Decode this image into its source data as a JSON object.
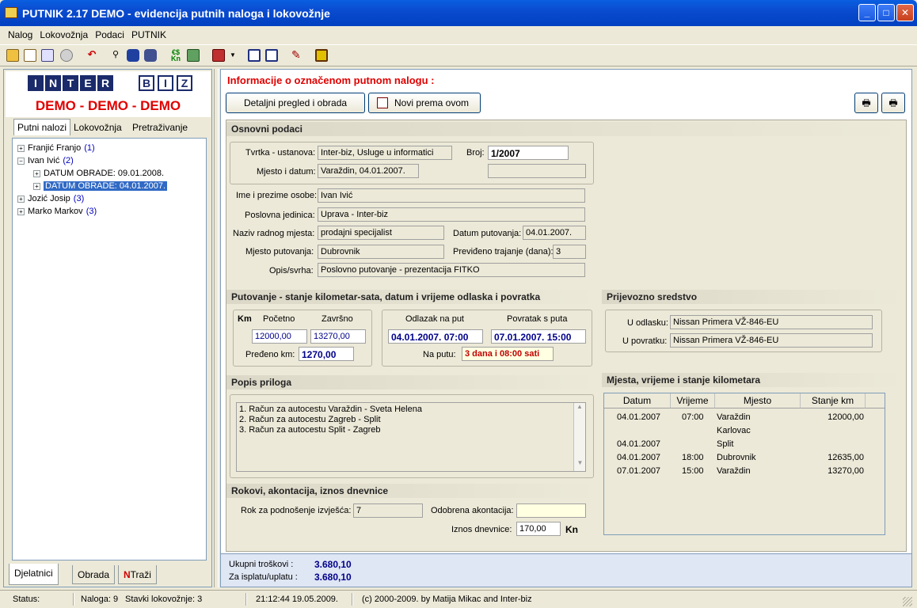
{
  "window": {
    "title": "PUTNIK 2.17 DEMO - evidencija putnih naloga i lokovožnje"
  },
  "menu": [
    "Nalog",
    "Lokovožnja",
    "Podaci",
    "PUTNIK"
  ],
  "logo": {
    "letters1": [
      "I",
      "N",
      "T",
      "E",
      "R"
    ],
    "letters2": [
      "B",
      "I",
      "Z"
    ],
    "demo": "DEMO - DEMO - DEMO"
  },
  "left_tabs": [
    "Putni nalozi",
    "Lokovožnja",
    "Pretraživanje"
  ],
  "tree": {
    "n1": {
      "name": "Franjić Franjo",
      "count": "(1)"
    },
    "n2": {
      "name": "Ivan Ivić",
      "count": "(2)"
    },
    "n2a": "DATUM OBRADE: 09.01.2008.",
    "n2b": "DATUM OBRADE: 04.01.2007.",
    "n3": {
      "name": "Jozić Josip",
      "count": "(3)"
    },
    "n4": {
      "name": "Marko Markov",
      "count": "(3)"
    }
  },
  "bottom_tabs": [
    "Djelatnici",
    "Obrada",
    "Traži"
  ],
  "main": {
    "title": "Informacije o označenom putnom nalogu :",
    "btn_detail": "Detaljni pregled i obrada",
    "btn_new": "Novi prema ovom"
  },
  "osnovni": {
    "section": "Osnovni podaci",
    "tvrtka_label": "Tvrtka - ustanova:",
    "tvrtka": "Inter-biz, Usluge u informatici",
    "broj_label": "Broj:",
    "broj": "1/2007",
    "mjesto_datum_label": "Mjesto i datum:",
    "mjesto_datum": "Varaždin, 04.01.2007.",
    "ime_label": "Ime i prezime osobe:",
    "ime": "Ivan Ivić",
    "jedinica_label": "Poslovna jedinica:",
    "jedinica": "Uprava - Inter-biz",
    "radno_label": "Naziv radnog mjesta:",
    "radno": "prodajni specijalist",
    "datum_put_label": "Datum putovanja:",
    "datum_put": "04.01.2007.",
    "mjesto_put_label": "Mjesto putovanja:",
    "mjesto_put": "Dubrovnik",
    "trajanje_label": "Previđeno trajanje (dana):",
    "trajanje": "3",
    "opis_label": "Opis/svrha:",
    "opis": "Poslovno putovanje - prezentacija FITKO"
  },
  "putovanje": {
    "section": "Putovanje - stanje kilometar-sata, datum i vrijeme odlaska i povratka",
    "km": "Km",
    "pocetno_label": "Početno",
    "zavrsno_label": "Završno",
    "pocetno": "12000,00",
    "zavrsno": "13270,00",
    "predeno_label": "Pređeno km:",
    "predeno": "1270,00",
    "odlazak_label": "Odlazak na put",
    "povratak_label": "Povratak s puta",
    "odlazak": "04.01.2007.   07:00",
    "povratak": "07.01.2007.   15:00",
    "naputu_label": "Na putu:",
    "naputu": "3 dana i 08:00 sati"
  },
  "prijevozno": {
    "section": "Prijevozno sredstvo",
    "odlasku_label": "U odlasku:",
    "odlasku": "Nissan Primera VŽ-846-EU",
    "povratku_label": "U povratku:",
    "povratku": "Nissan Primera VŽ-846-EU"
  },
  "prilozi": {
    "section": "Popis priloga",
    "items": [
      "1. Račun za autocestu Varaždin - Sveta Helena",
      "2. Račun za autocestu Zagreb - Split",
      "3. Račun za autocestu Split - Zagreb"
    ]
  },
  "mjesta": {
    "section": "Mjesta, vrijeme i stanje kilometara",
    "columns": [
      "Datum",
      "Vrijeme",
      "Mjesto",
      "Stanje km"
    ],
    "rows": [
      [
        "04.01.2007",
        "07:00",
        "Varaždin",
        "12000,00"
      ],
      [
        "",
        "",
        "Karlovac",
        ""
      ],
      [
        "04.01.2007",
        "",
        "Split",
        ""
      ],
      [
        "04.01.2007",
        "18:00",
        "Dubrovnik",
        "12635,00"
      ],
      [
        "07.01.2007",
        "15:00",
        "Varaždin",
        "13270,00"
      ]
    ]
  },
  "rokovi": {
    "section": "Rokovi, akontacija, iznos dnevnice",
    "rok_label": "Rok za podnošenje izvješća:",
    "rok": "7",
    "akontacija_label": "Odobrena akontacija:",
    "akontacija": "",
    "dnevnica_label": "Iznos dnevnice:",
    "dnevnica": "170,00",
    "valuta": "Kn"
  },
  "footer": {
    "ukupni_label": "Ukupni troškovi :",
    "ukupni": "3.680,10",
    "isplata_label": "Za isplatu/uplatu :",
    "isplata": "3.680,10"
  },
  "status": {
    "label": "Status:",
    "naloga": "Naloga: 9",
    "stavki": "Stavki lokovožnje: 3",
    "datetime": "21:12:44   19.05.2009.",
    "copyright": "(c) 2000-2009. by Matija Mikac and Inter-biz"
  },
  "colors": {
    "accent": "#e00000",
    "selection": "#316ac5",
    "value_blue": "#00008b"
  }
}
